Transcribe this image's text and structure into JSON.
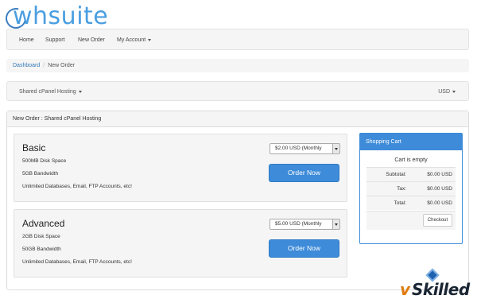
{
  "brand": {
    "logo_text": "whsuite"
  },
  "nav": {
    "items": [
      {
        "label": "Home"
      },
      {
        "label": "Support"
      },
      {
        "label": "New Order"
      },
      {
        "label": "My Account"
      }
    ]
  },
  "breadcrumb": {
    "home": "Dashboard",
    "current": "New Order"
  },
  "toolbar": {
    "category": "Shared cPanel Hosting",
    "currency": "USD"
  },
  "panel": {
    "title": "New Order : Shared cPanel Hosting"
  },
  "plans": [
    {
      "name": "Basic",
      "features": [
        "500MB Disk Space",
        "5GB Bandwidth",
        "Unlimited Databases, Email, FTP Accounts, etc!"
      ],
      "price_option": "$2.00 USD (Monthly",
      "button": "Order Now"
    },
    {
      "name": "Advanced",
      "features": [
        "2GB Disk Space",
        "50GB Bandwidth",
        "Unlimited Databases, Email, FTP Accounts, etc!"
      ],
      "price_option": "$5.00 USD (Monthly",
      "button": "Order Now"
    }
  ],
  "cart": {
    "title": "Shopping Cart",
    "empty_text": "Cart is empty",
    "rows": [
      {
        "label": "Subtotal:",
        "value": "$0.00 USD"
      },
      {
        "label": "Tax:",
        "value": "$0.00 USD"
      },
      {
        "label": "Total:",
        "value": "$0.00 USD"
      }
    ],
    "checkout": "Checkout"
  },
  "watermark": {
    "v": "v",
    "rest": "Skilled"
  },
  "colors": {
    "accent": "#3d8bd9",
    "link": "#337ab7",
    "panel_bg": "#f5f5f5"
  }
}
